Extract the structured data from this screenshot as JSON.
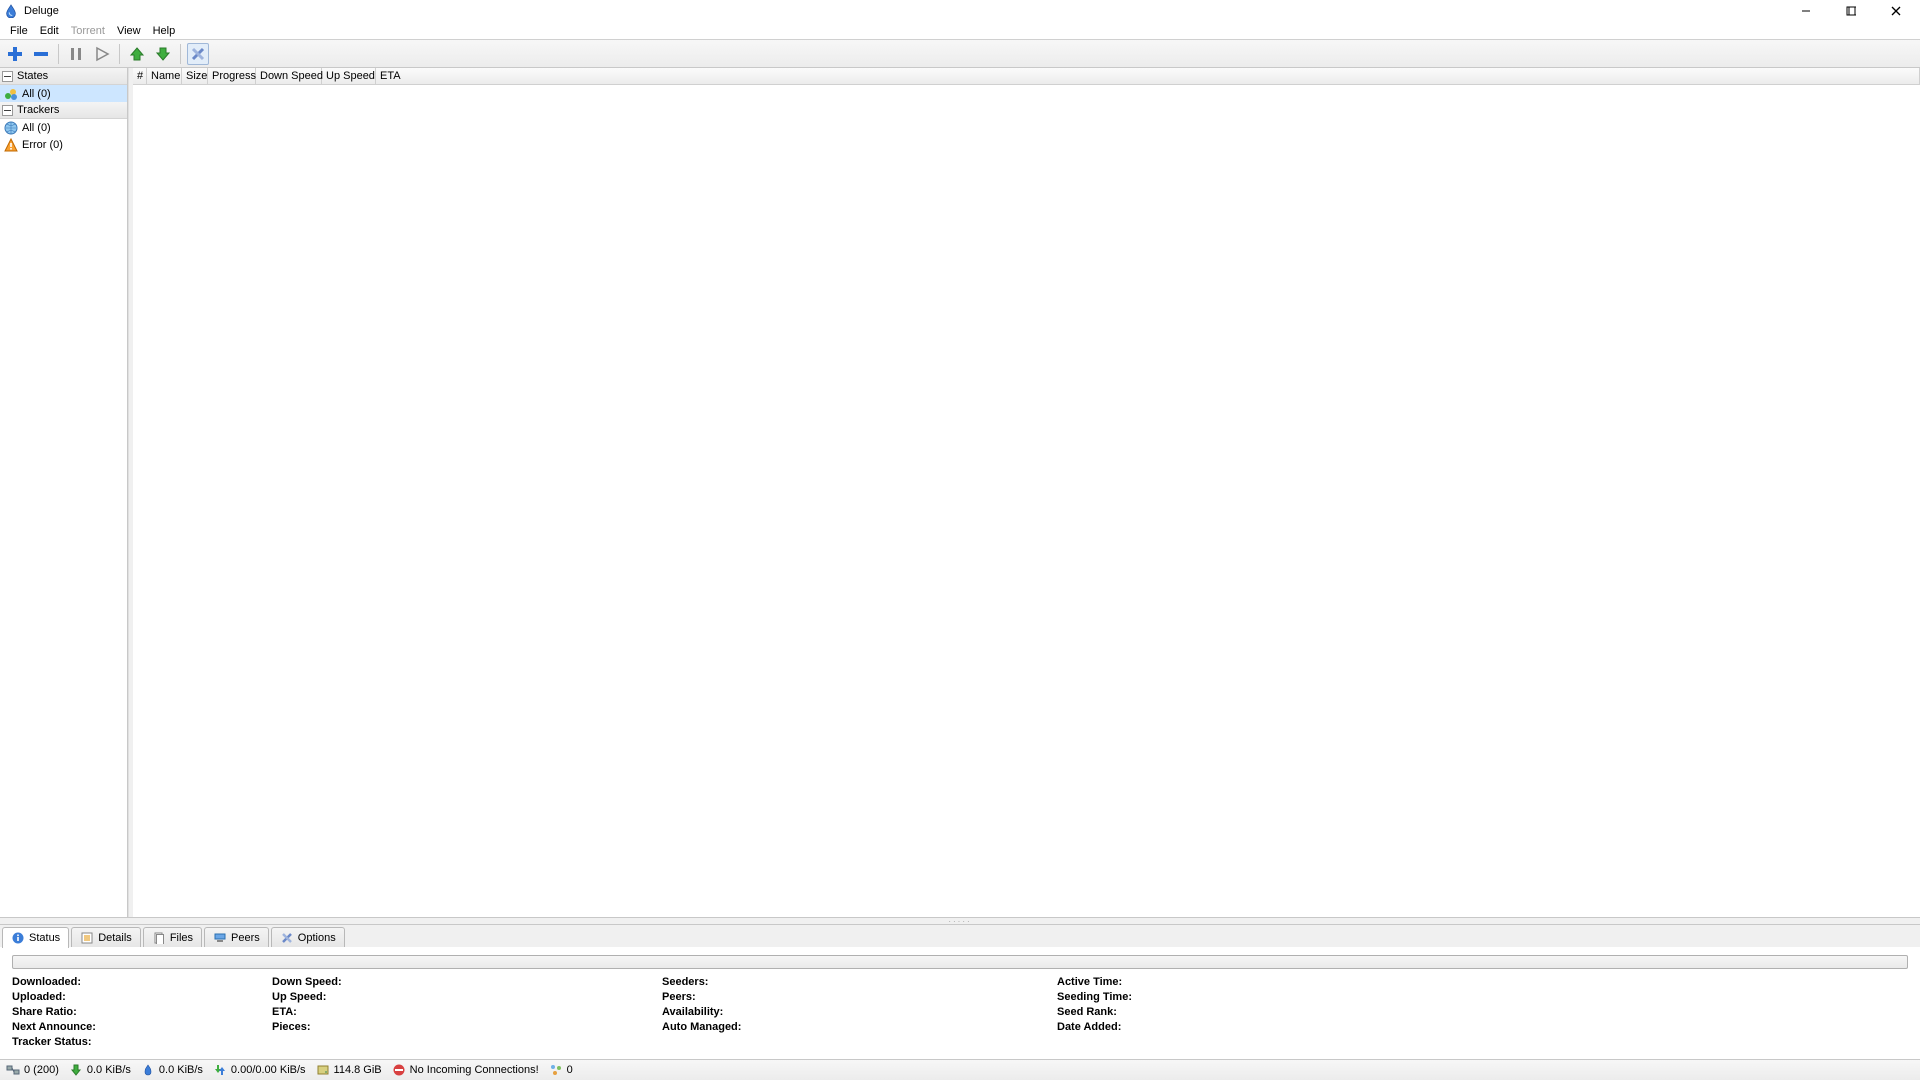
{
  "title": "Deluge",
  "menu": {
    "file": "File",
    "edit": "Edit",
    "torrent": "Torrent",
    "view": "View",
    "help": "Help"
  },
  "sidebar": {
    "states_header": "States",
    "states_all": "All (0)",
    "trackers_header": "Trackers",
    "trackers_all": "All (0)",
    "trackers_error": "Error (0)"
  },
  "columns": {
    "num": "#",
    "name": "Name",
    "size": "Size",
    "progress": "Progress",
    "down": "Down Speed",
    "up": "Up Speed",
    "eta": "ETA"
  },
  "tabs": {
    "status": "Status",
    "details": "Details",
    "files": "Files",
    "peers": "Peers",
    "options": "Options"
  },
  "details": {
    "downloaded": "Downloaded:",
    "uploaded": "Uploaded:",
    "share_ratio": "Share Ratio:",
    "next_announce": "Next Announce:",
    "tracker_status": "Tracker Status:",
    "down_speed": "Down Speed:",
    "up_speed": "Up Speed:",
    "eta": "ETA:",
    "pieces": "Pieces:",
    "seeders": "Seeders:",
    "peers": "Peers:",
    "availability": "Availability:",
    "auto_managed": "Auto Managed:",
    "active_time": "Active Time:",
    "seeding_time": "Seeding Time:",
    "seed_rank": "Seed Rank:",
    "date_added": "Date Added:"
  },
  "statusbar": {
    "connections": "0 (200)",
    "down": "0.0 KiB/s",
    "up": "0.0 KiB/s",
    "protocol": "0.00/0.00 KiB/s",
    "disk": "114.8 GiB",
    "warning": "No Incoming Connections!",
    "dht": "0"
  }
}
